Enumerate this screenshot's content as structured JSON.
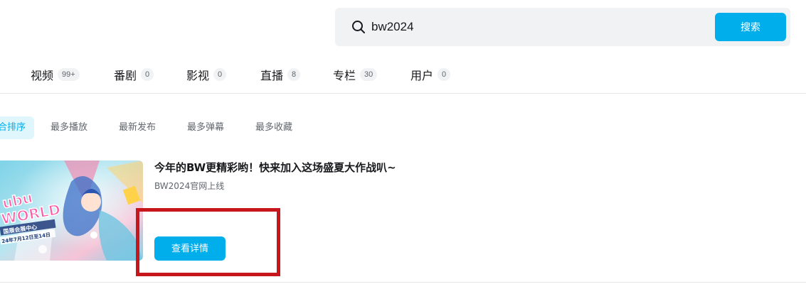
{
  "search": {
    "value": "bw2024",
    "button_label": "搜索"
  },
  "tabs": [
    {
      "label": "视频",
      "count": "99+"
    },
    {
      "label": "番剧",
      "count": "0"
    },
    {
      "label": "影视",
      "count": "0"
    },
    {
      "label": "直播",
      "count": "8"
    },
    {
      "label": "专栏",
      "count": "30"
    },
    {
      "label": "用户",
      "count": "0"
    }
  ],
  "sort": [
    {
      "label": "综合排序",
      "active": true
    },
    {
      "label": "最多播放"
    },
    {
      "label": "最新发布"
    },
    {
      "label": "最多弹幕"
    },
    {
      "label": "最多收藏"
    }
  ],
  "card": {
    "title": "今年的BW更精彩哟！快来加入这场盛夏大作战叭~",
    "subtitle": "BW2024官网上线",
    "button_label": "查看详情",
    "thumbnail": {
      "headline": "WORLD",
      "line1": "国展会展中心",
      "line2": "24年7月12日至14日"
    }
  },
  "colors": {
    "accent": "#00aeec",
    "highlight": "#c8161d"
  }
}
